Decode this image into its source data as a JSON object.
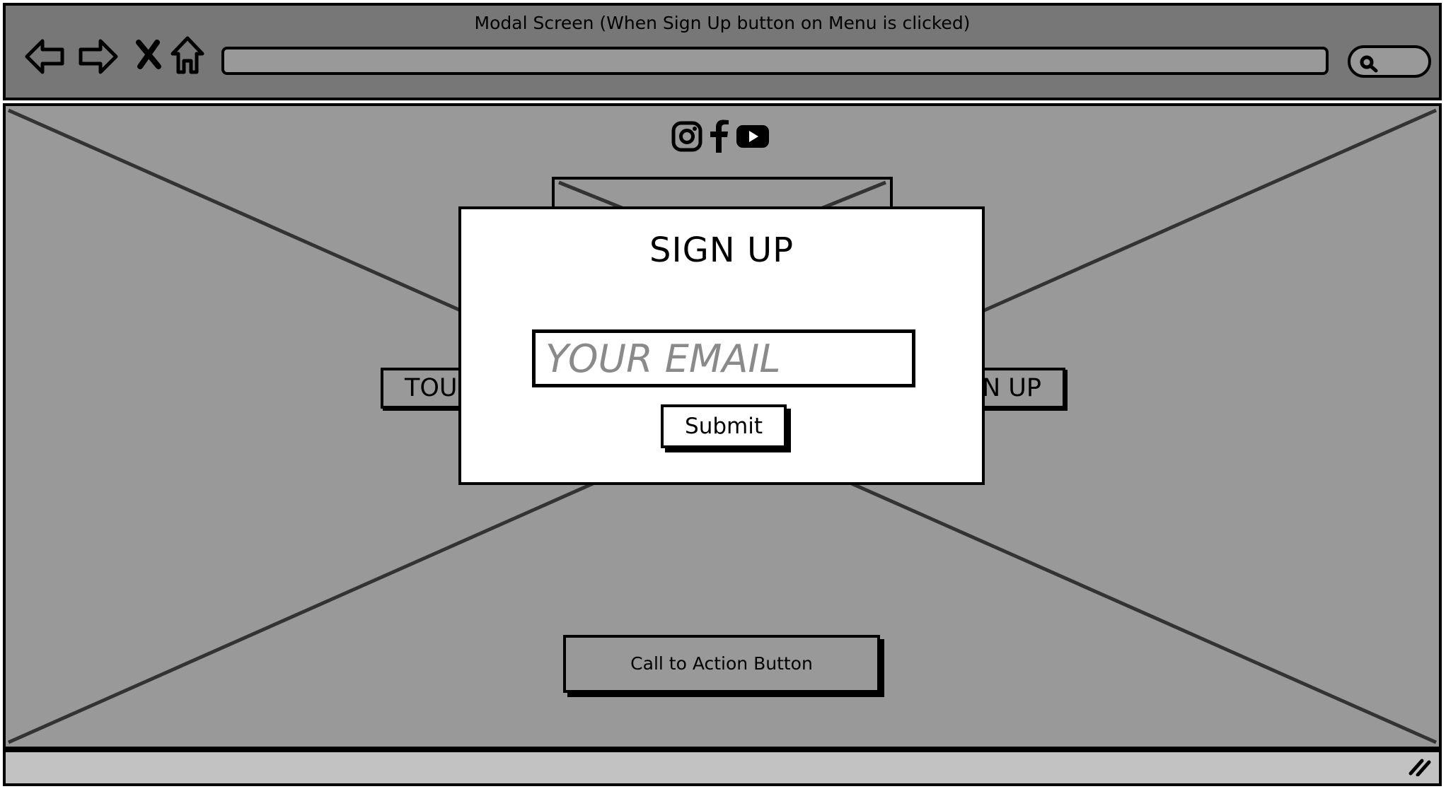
{
  "window": {
    "title": "Modal Screen (When Sign Up button on Menu is clicked)"
  },
  "toolbar": {
    "icons": [
      "back-arrow-icon",
      "forward-arrow-icon",
      "close-icon",
      "home-icon"
    ],
    "address_value": "",
    "search_icon": "search-icon"
  },
  "page": {
    "social_icons": [
      "instagram-icon",
      "facebook-icon",
      "youtube-icon"
    ],
    "menu": {
      "left_label": "TOU",
      "right_label": "N UP"
    },
    "cta_label": "Call to Action Button"
  },
  "modal": {
    "title": "SIGN UP",
    "email_placeholder": "YOUR EMAIL",
    "submit_label": "Submit"
  },
  "colors": {
    "chrome_bg": "#777777",
    "viewport_bg": "#999999",
    "statusbar_bg": "#c2c2c2",
    "modal_bg": "#ffffff",
    "border": "#000000",
    "placeholder": "#8a8a8a"
  }
}
